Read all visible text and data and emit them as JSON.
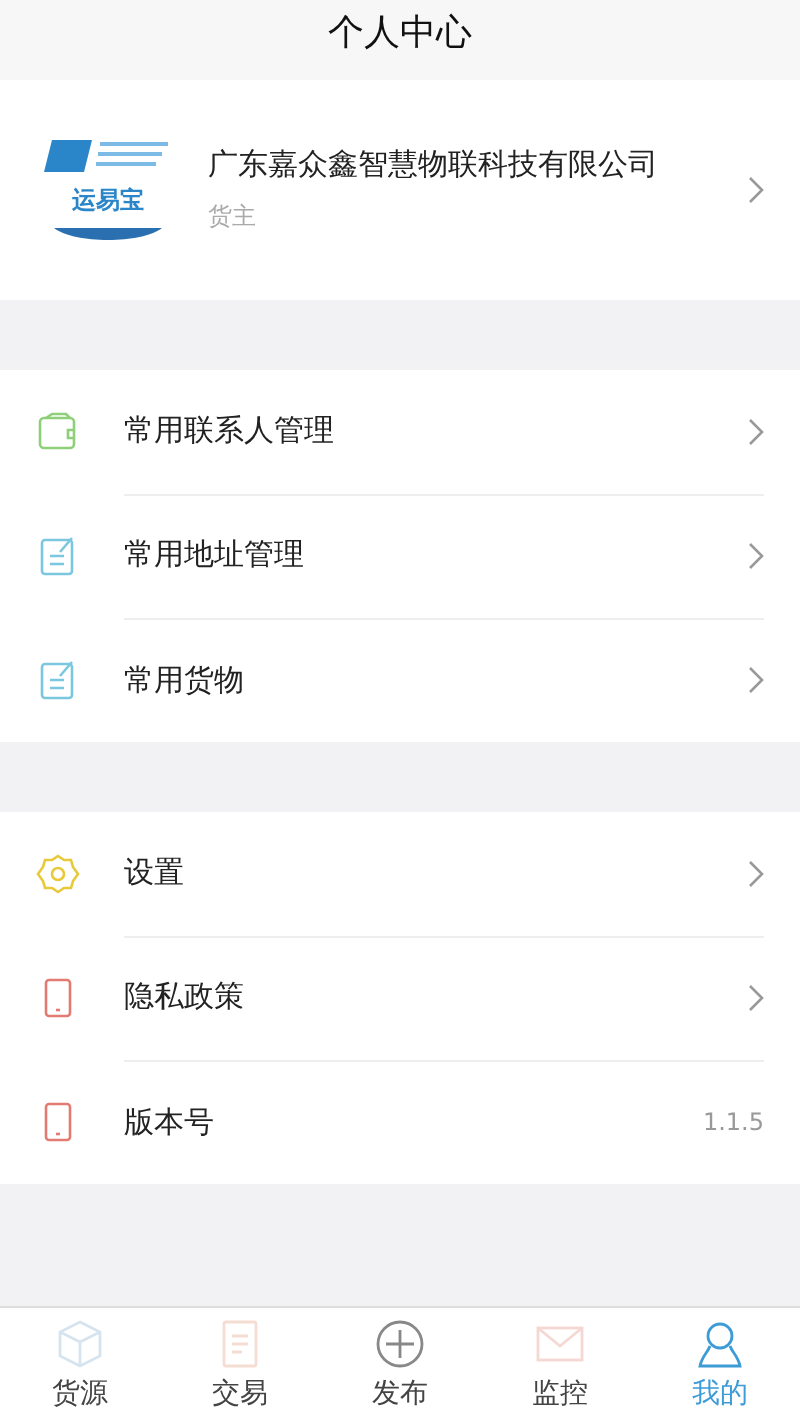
{
  "title": "个人中心",
  "profile": {
    "logo_text": "运易宝",
    "name": "广东嘉众鑫智慧物联科技有限公司",
    "role": "货主"
  },
  "sections": [
    {
      "items": [
        {
          "label": "常用联系人管理"
        },
        {
          "label": "常用地址管理"
        },
        {
          "label": "常用货物"
        }
      ]
    },
    {
      "items": [
        {
          "label": "设置"
        },
        {
          "label": "隐私政策"
        },
        {
          "label": "版本号",
          "value": "1.1.5"
        }
      ]
    }
  ],
  "tabs": [
    {
      "label": "货源",
      "selected": false
    },
    {
      "label": "交易",
      "selected": false
    },
    {
      "label": "发布",
      "selected": false
    },
    {
      "label": "监控",
      "selected": false
    },
    {
      "label": "我的",
      "selected": true
    }
  ]
}
